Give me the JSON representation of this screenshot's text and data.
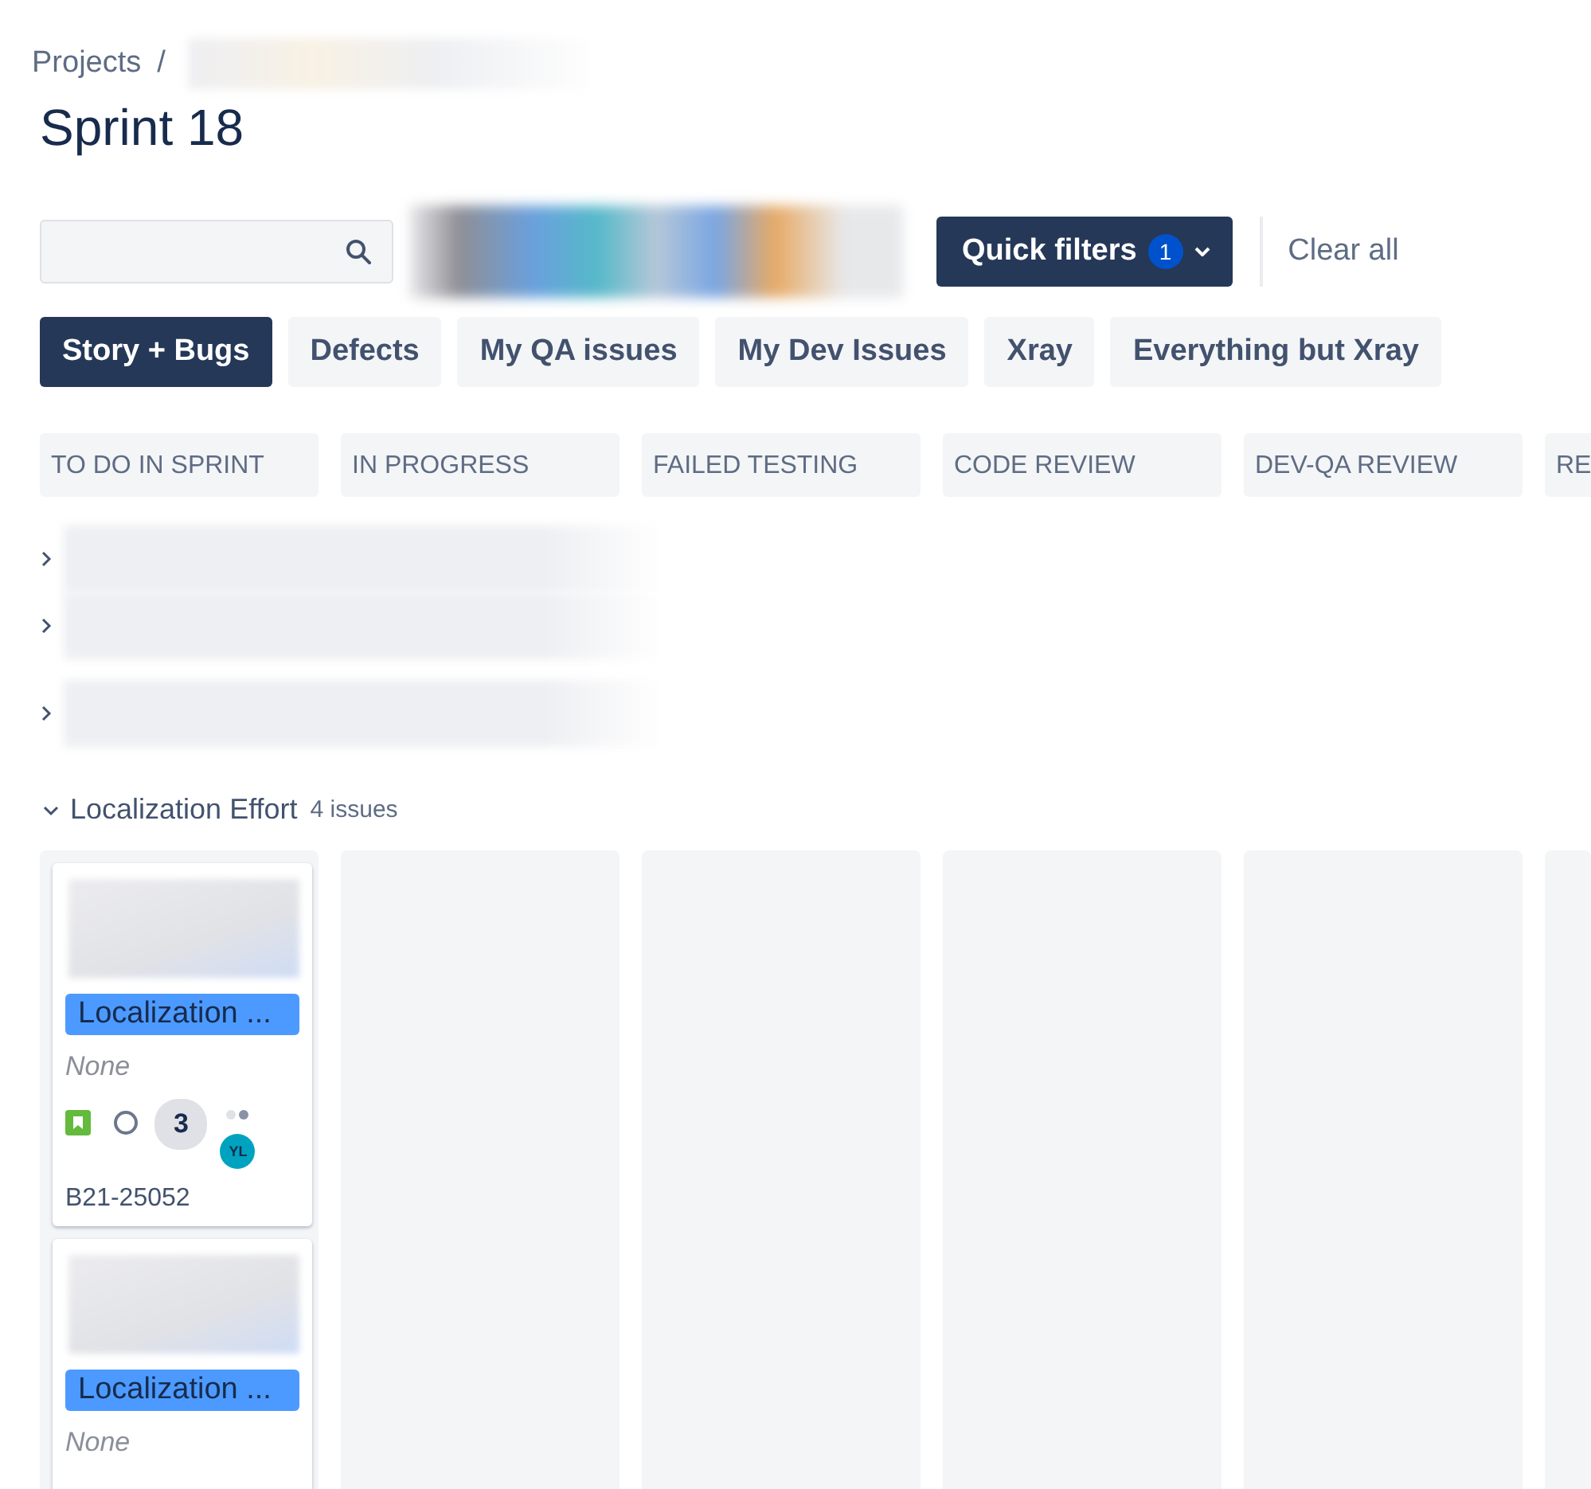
{
  "breadcrumb": {
    "items": [
      "Projects"
    ],
    "separator": "/"
  },
  "title": "Sprint 18",
  "quick_filters_button": {
    "label": "Quick filters",
    "count": "1"
  },
  "clear_all": "Clear all",
  "filters": [
    {
      "label": "Story + Bugs",
      "selected": true
    },
    {
      "label": "Defects",
      "selected": false
    },
    {
      "label": "My QA issues",
      "selected": false
    },
    {
      "label": "My Dev Issues",
      "selected": false
    },
    {
      "label": "Xray",
      "selected": false
    },
    {
      "label": "Everything but Xray",
      "selected": false
    }
  ],
  "columns": [
    "TO DO IN SPRINT",
    "IN PROGRESS",
    "FAILED TESTING",
    "CODE REVIEW",
    "DEV-QA REVIEW",
    "RE"
  ],
  "collapsed_swimlanes": [
    {
      "expanded": false
    },
    {
      "expanded": false
    },
    {
      "expanded": false
    }
  ],
  "swimlane": {
    "title": "Localization Effort",
    "count": "4 issues",
    "expanded": true,
    "cards": [
      {
        "label": "Localization ...",
        "fix_version": "None",
        "kind": "story",
        "estimate": "3",
        "assignee_initials": "YL",
        "key": "B21-25052"
      },
      {
        "label": "Localization ...",
        "fix_version": "None"
      }
    ]
  }
}
